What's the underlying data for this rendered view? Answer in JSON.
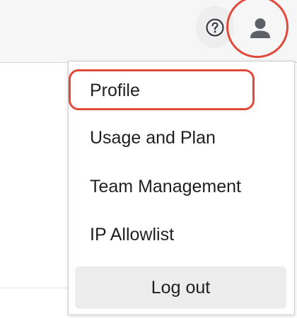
{
  "header": {
    "help_icon": "question-circle-icon",
    "account_icon": "person-icon"
  },
  "account_menu": {
    "items": [
      {
        "label": "Profile"
      },
      {
        "label": "Usage and Plan"
      },
      {
        "label": "Team Management"
      },
      {
        "label": "IP Allowlist"
      }
    ],
    "logout_label": "Log out"
  },
  "highlights": {
    "color": "#e14a3b"
  }
}
